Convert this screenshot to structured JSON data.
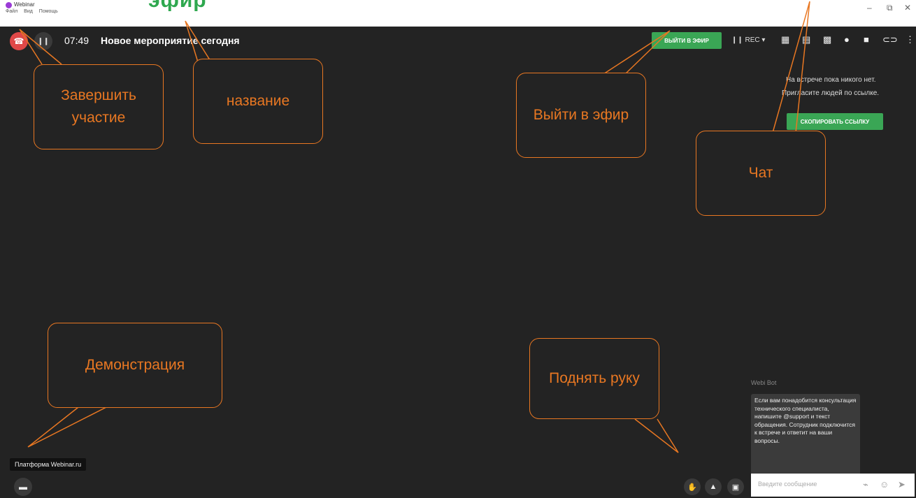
{
  "window": {
    "title": "Webinar",
    "menu": [
      "Файл",
      "Вид",
      "Помощь"
    ],
    "overlay_title": "эфир",
    "controls": {
      "minimize": "–",
      "restore": "⧉",
      "close": "✕"
    }
  },
  "topbar": {
    "timer": "07:49",
    "event_title": "Новое мероприятие сегодня",
    "go_live_label": "ВЫЙТИ В ЭФИР",
    "rec_label": "❙❙ REC ▾"
  },
  "sidebar": {
    "empty_line1": "На встрече пока никого нет.",
    "empty_line2": "Пригласите людей по ссылке.",
    "copy_link_label": "СКОПИРОВАТЬ ССЫЛКУ"
  },
  "chat": {
    "bot_name": "Webi Bot",
    "bot_message": "Если вам понадобится консультация технического специалиста, напишите @support и текст обращения. Сотрудник подключится к встрече и ответит на ваши вопросы.",
    "input_placeholder": "Введите сообщение"
  },
  "bottom": {
    "platform_label": "Платформа Webinar.ru"
  },
  "callouts": {
    "end": "Завершить участие",
    "title": "название",
    "go_live": "Выйти в эфир",
    "chat": "Чат",
    "demo": "Демонстрация",
    "hand": "Поднять руку"
  },
  "colors": {
    "background": "#232323",
    "accent_green": "#3aa655",
    "end_call_red": "#e04848",
    "callout_orange": "#e87722"
  }
}
